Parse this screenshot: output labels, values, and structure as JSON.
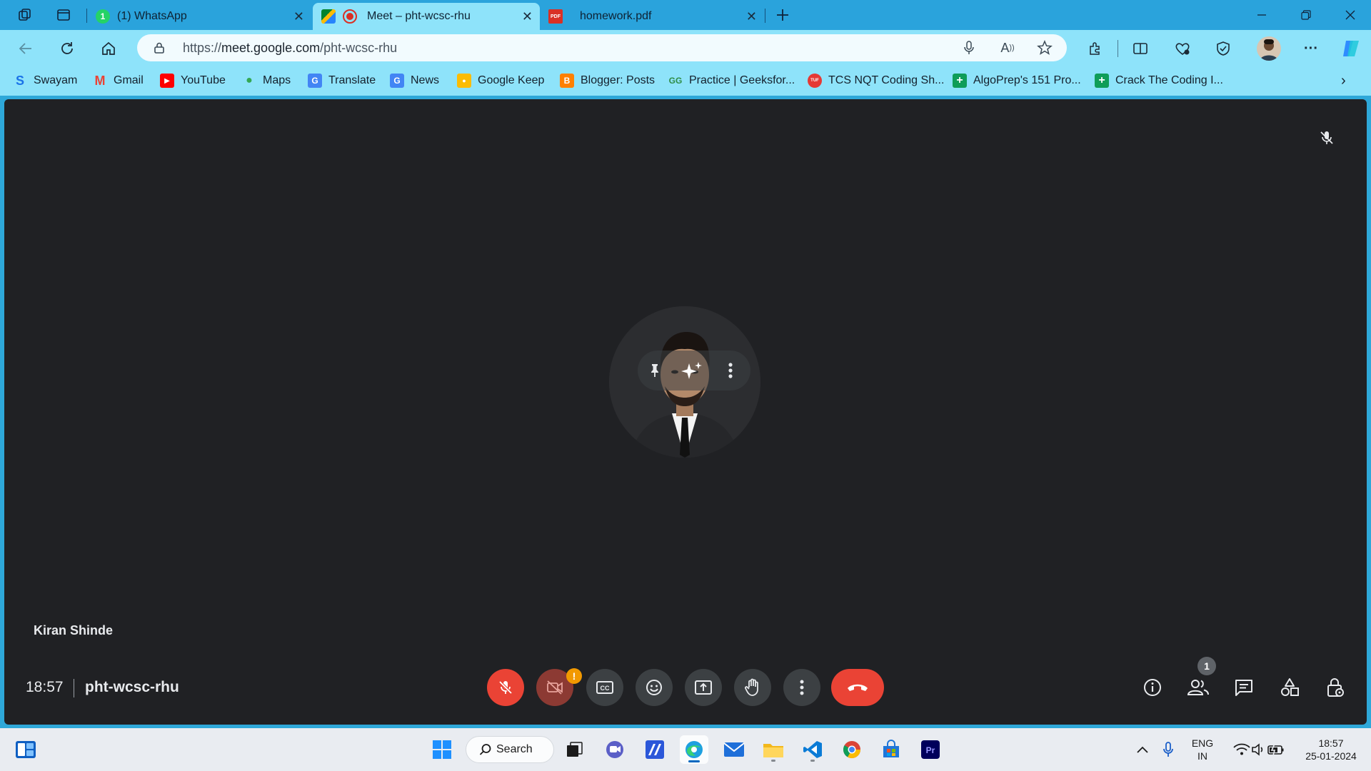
{
  "browser": {
    "tabs": [
      {
        "title": "(1) WhatsApp",
        "active": false,
        "favicon": "whatsapp-icon",
        "badge": "1"
      },
      {
        "title": "Meet – pht-wcsc-rhu",
        "active": true,
        "favicon": "google-meet-icon"
      },
      {
        "title": "homework.pdf",
        "active": false,
        "favicon": "pdf-icon",
        "favicon_text": "PDF"
      }
    ],
    "url_prefix": "https://",
    "url_host": "meet.google.com",
    "url_path": "/pht-wcsc-rhu",
    "bookmarks": [
      {
        "label": "Swayam",
        "icon": "S",
        "color": "#1a73e8"
      },
      {
        "label": "Gmail",
        "icon": "M",
        "color": "#ea4335"
      },
      {
        "label": "YouTube",
        "icon": "▶",
        "color": "#ff0000"
      },
      {
        "label": "Maps",
        "icon": "●",
        "color": "#34a853"
      },
      {
        "label": "Translate",
        "icon": "G",
        "color": "#4285f4"
      },
      {
        "label": "News",
        "icon": "G",
        "color": "#4285f4"
      },
      {
        "label": "Google Keep",
        "icon": "●",
        "color": "#fbbc04"
      },
      {
        "label": "Blogger: Posts",
        "icon": "B",
        "color": "#ff8000"
      },
      {
        "label": "Practice | Geeksfor...",
        "icon": "GG",
        "color": "#2f8d46"
      },
      {
        "label": "TCS NQT Coding Sh...",
        "icon": "TUF",
        "color": "#e53935"
      },
      {
        "label": "AlgoPrep's 151 Pro...",
        "icon": "+",
        "color": "#0f9d58"
      },
      {
        "label": "Crack The Coding I...",
        "icon": "+",
        "color": "#0f9d58"
      }
    ]
  },
  "meet": {
    "participant_name": "Kiran Shinde",
    "time": "18:57",
    "meeting_code": "pht-wcsc-rhu",
    "camera_warning_badge": "!",
    "people_count": "1"
  },
  "taskbar": {
    "search_label": "Search",
    "language_line1": "ENG",
    "language_line2": "IN",
    "clock_time": "18:57",
    "clock_date": "25-01-2024"
  },
  "colors": {
    "browser_frame": "#2aa3dc",
    "toolbar": "#8ee3fa",
    "meet_background": "#202124",
    "mic_off_red": "#ea4335",
    "hangup_red": "#ea4335"
  }
}
